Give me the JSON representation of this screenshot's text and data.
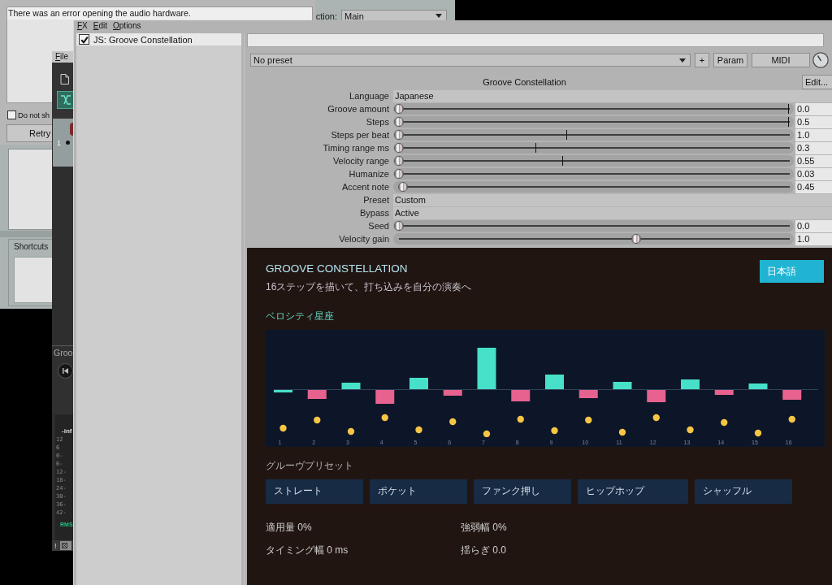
{
  "error_dialog": {
    "message": "There was an error opening the audio hardware.",
    "checkbox": {
      "label": "Do not sh",
      "checked": false
    },
    "buttons": [
      "Retry"
    ]
  },
  "actions_window": {
    "section_label": "ction:",
    "section": "Main",
    "shortcuts_label": "Shortcuts"
  },
  "main_window": {
    "menu": [
      "File"
    ],
    "track": {
      "number": "1"
    },
    "transport_label": "Groo",
    "meter": {
      "peak": "-inf",
      "scale": [
        "12",
        "6",
        "0-",
        "6-",
        "12-",
        "18-",
        "24-",
        "30-",
        "36-",
        "42-"
      ],
      "mode": "RMS"
    },
    "status_mark": "!"
  },
  "fx_window": {
    "menu": [
      "FX",
      "Edit",
      "Options"
    ],
    "fx_list": [
      {
        "name": "JS: Groove Constellation",
        "enabled": true,
        "selected": true
      }
    ],
    "preset": "No preset",
    "preset_buttons": [
      "+",
      "Param",
      "MIDI"
    ],
    "plugin_title": "Groove Constellation",
    "edit_button": "Edit...",
    "params": [
      {
        "kind": "text",
        "label": "Language",
        "value": "Japanese"
      },
      {
        "kind": "slider",
        "label": "Groove amount",
        "level": 0,
        "value": "0.0",
        "marker": {
          "level": 1.0
        }
      },
      {
        "kind": "slider",
        "label": "Steps",
        "level": 0,
        "value": "0.5",
        "marker": {
          "level": 1.0
        }
      },
      {
        "kind": "slider",
        "label": "Steps per beat",
        "level": 0,
        "value": "1.0",
        "marker": {
          "level": 0.43
        }
      },
      {
        "kind": "slider",
        "label": "Timing range ms",
        "level": 0,
        "value": "0.3",
        "marker": {
          "level": 0.35
        }
      },
      {
        "kind": "slider",
        "label": "Velocity range",
        "level": 0,
        "value": "0.55",
        "marker": {
          "level": 0.42
        }
      },
      {
        "kind": "slider",
        "label": "Humanize",
        "level": 0,
        "value": "0.03"
      },
      {
        "kind": "slider",
        "label": "Accent note",
        "level": 0.01,
        "value": "0.45"
      },
      {
        "kind": "text",
        "label": "Preset",
        "value": "Custom"
      },
      {
        "kind": "text",
        "label": "Bypass",
        "value": "Active"
      },
      {
        "kind": "slider",
        "label": "Seed",
        "level": 0,
        "value": "0.0"
      },
      {
        "kind": "slider",
        "label": "Velocity gain",
        "level": 0.61,
        "value": "1.0"
      }
    ],
    "plugin_ui": {
      "title": "GROOVE CONSTELLATION",
      "subtitle": "16ステップを描いて、打ち込みを自分の演奏へ",
      "language_button": "日本語",
      "chart_label": "ベロシティ星座",
      "step_labels": [
        "1",
        "2",
        "3",
        "4",
        "5",
        "6",
        "7",
        "8",
        "9",
        "10",
        "11",
        "12",
        "13",
        "14",
        "15",
        "16"
      ],
      "presets_label": "グルーヴプリセット",
      "presets": [
        "ストレート",
        "ポケット",
        "ファンク押し",
        "ヒップホップ",
        "シャッフル"
      ],
      "stats": [
        "適用量 0%",
        "強弱幅 0%",
        "タイミング幅 0 ms",
        "揺らぎ 0.0"
      ]
    }
  }
}
